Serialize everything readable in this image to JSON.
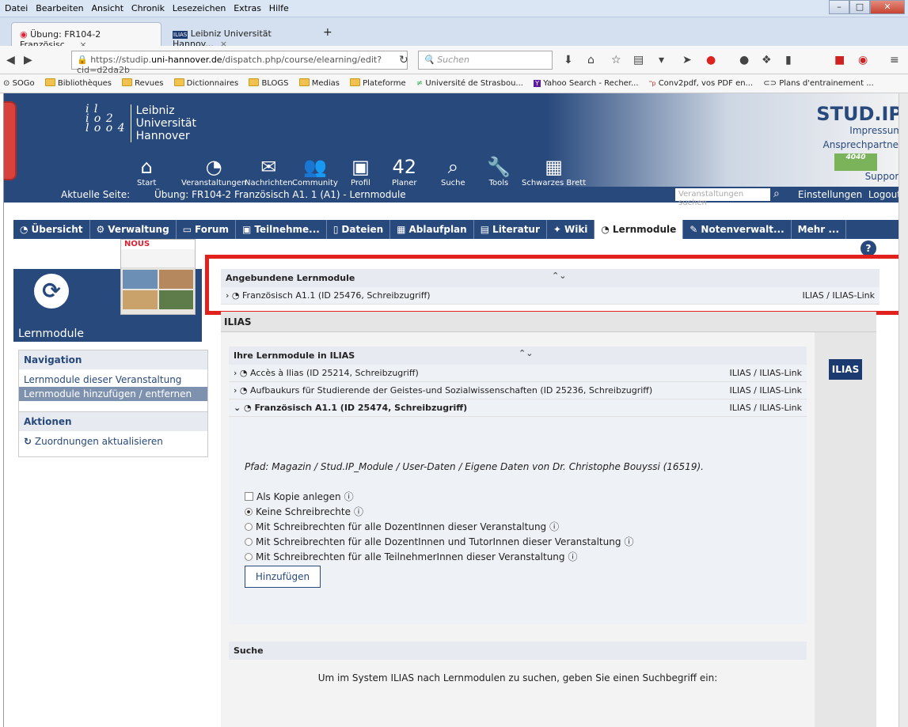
{
  "browser": {
    "menu": [
      "Datei",
      "Bearbeiten",
      "Ansicht",
      "Chronik",
      "Lesezeichen",
      "Extras",
      "Hilfe"
    ],
    "tabs": [
      {
        "label": "Übung: FR104-2 Französisc...",
        "close": "×"
      },
      {
        "label": "Leibniz Universität Hannov...",
        "close": "×"
      },
      {
        "label": "+"
      }
    ],
    "url": {
      "prefix": "https://studip.",
      "domain": "uni-hannover.de",
      "rest": "/dispatch.php/course/elearning/edit?cid=d2da2b"
    },
    "search_placeholder": "Suchen",
    "bookmarks": [
      "SOGo",
      "Bibliothèques",
      "Revues",
      "Dictionnaires",
      "BLOGS",
      "Medias",
      "Plateforme",
      "Université de Strasbou...",
      "Yahoo Search - Recher...",
      "Conv2pdf, vos PDF en...",
      "Plans d'entrainement ..."
    ]
  },
  "header": {
    "logo_mark": "i l\ni o 2\nl o o 4",
    "university": [
      "Leibniz",
      "Universität",
      "Hannover"
    ],
    "brand": "STUD.IP",
    "links": [
      "Impressum",
      "Ansprechpartner",
      "Support"
    ],
    "nav": [
      "Start",
      "Veranstaltungen",
      "Nachrichten",
      "Community",
      "Profil",
      "Planer",
      "Suche",
      "Tools",
      "Schwarzes Brett"
    ],
    "planer_badge": "42"
  },
  "breadcrumb": {
    "label": "Aktuelle Seite:",
    "value": "Übung: FR104-2 Französisch A1. 1 (A1) - Lernmodule",
    "search_placeholder": "Veranstaltungen suchen",
    "settings": "Einstellungen",
    "logout": "Logout"
  },
  "course_tabs": [
    "Übersicht",
    "Verwaltung",
    "Forum",
    "Teilnehme...",
    "Dateien",
    "Ablaufplan",
    "Literatur",
    "Wiki",
    "Lernmodule",
    "Notenverwalt...",
    "Mehr ..."
  ],
  "sidebar": {
    "title": "Lernmodule",
    "image_label": "NOUS",
    "navigation_title": "Navigation",
    "nav_items": [
      "Lernmodule dieser Veranstaltung",
      "Lernmodule hinzufügen / entfernen"
    ],
    "actions_title": "Aktionen",
    "actions": [
      "Zuordnungen aktualisieren"
    ]
  },
  "linked": {
    "title": "Angebundene Lernmodule",
    "rows": [
      {
        "name": "Französisch A1.1 (ID 25476, Schreibzugriff)",
        "type": "ILIAS / ILIAS-Link"
      }
    ]
  },
  "ilias": {
    "title": "ILIAS",
    "logo": "ILIAS",
    "list_title": "Ihre Lernmodule in ILIAS",
    "rows": [
      {
        "name": "Accès à Ilias (ID 25214, Schreibzugriff)",
        "type": "ILIAS / ILIAS-Link"
      },
      {
        "name": "Aufbaukurs für Studierende der Geistes-und Sozialwissenschaften (ID 25236, Schreibzugriff)",
        "type": "ILIAS / ILIAS-Link"
      },
      {
        "name": "Französisch A1.1 (ID 25474, Schreibzugriff)",
        "type": "ILIAS / ILIAS-Link"
      }
    ],
    "path": "Pfad: Magazin / Stud.IP_Module / User-Daten / Eigene Daten von Dr. Christophe Bouyssi (16519).",
    "copy_label": "Als Kopie anlegen",
    "options": [
      "Keine Schreibrechte",
      "Mit Schreibrechten für alle DozentInnen dieser Veranstaltung",
      "Mit Schreibrechten für alle DozentInnen und TutorInnen dieser Veranstaltung",
      "Mit Schreibrechten für alle TeilnehmerInnen dieser Veranstaltung"
    ],
    "add_button": "Hinzufügen",
    "search_title": "Suche",
    "search_hint": "Um im System ILIAS nach Lernmodulen zu suchen, geben Sie einen Suchbegriff ein:"
  }
}
